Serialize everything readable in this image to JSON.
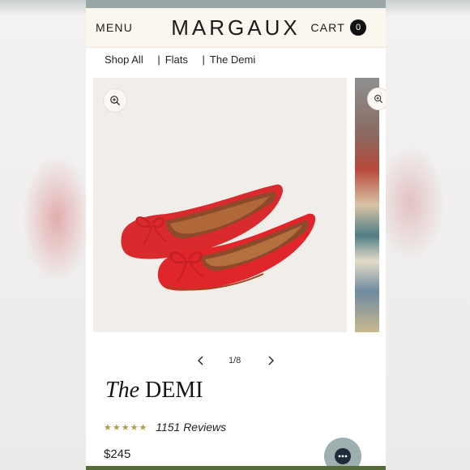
{
  "header": {
    "menu_label": "MENU",
    "brand": "MARGAUX",
    "cart_label": "CART",
    "cart_count": "0"
  },
  "breadcrumb": {
    "items": [
      "Shop All",
      "Flats",
      "The Demi"
    ],
    "separator": "|"
  },
  "gallery": {
    "current": "1/8",
    "product_color": "#e0262b"
  },
  "product": {
    "title_prefix": "The",
    "title_name": "DEMI",
    "stars": "★★★★★",
    "reviews": "1151 Reviews",
    "price": "$245"
  },
  "icons": {
    "zoom": "zoom-in-icon",
    "prev": "chevron-left-icon",
    "next": "chevron-right-icon",
    "chat": "chat-icon"
  },
  "colors": {
    "header_bg": "#fbf6ee",
    "accent_gold": "#b29a4a",
    "footer_green": "#556b3a"
  }
}
